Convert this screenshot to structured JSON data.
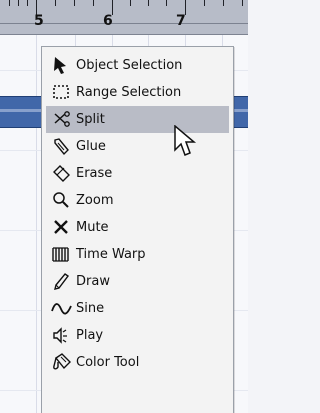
{
  "ruler": {
    "labels": [
      "5",
      "6",
      "7"
    ]
  },
  "menu": {
    "items": [
      {
        "label": "Object Selection",
        "icon": "arrow-pointer-icon"
      },
      {
        "label": "Range Selection",
        "icon": "range-selection-icon"
      },
      {
        "label": "Split",
        "icon": "scissors-icon",
        "selected": true
      },
      {
        "label": "Glue",
        "icon": "glue-tube-icon"
      },
      {
        "label": "Erase",
        "icon": "eraser-icon"
      },
      {
        "label": "Zoom",
        "icon": "magnifier-icon"
      },
      {
        "label": "Mute",
        "icon": "x-mark-icon"
      },
      {
        "label": "Time Warp",
        "icon": "time-warp-icon"
      },
      {
        "label": "Draw",
        "icon": "pencil-icon"
      },
      {
        "label": "Sine",
        "icon": "sine-wave-icon"
      },
      {
        "label": "Play",
        "icon": "speaker-icon"
      },
      {
        "label": "Color Tool",
        "icon": "paint-bucket-icon"
      }
    ]
  },
  "colors": {
    "track_band": "#4167a9",
    "selected_item": "#b9bcc6",
    "ruler": "#b7bcc8"
  }
}
